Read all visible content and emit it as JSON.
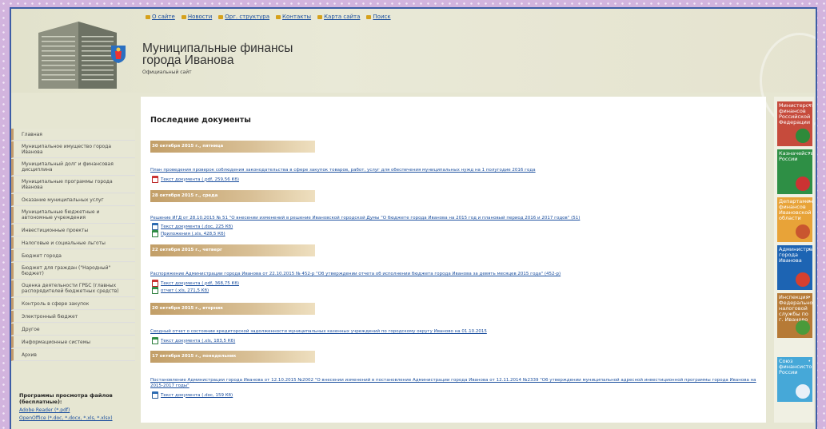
{
  "header": {
    "title_line1": "Муниципальные финансы",
    "title_line2": "города Иванова",
    "subtitle": "Официальный сайт"
  },
  "topnav": [
    "О сайте",
    "Новости",
    "Орг. структура",
    "Контакты",
    "Карта сайта",
    "Поиск"
  ],
  "sidebar": [
    "Главная",
    "Муниципальное имущество города Иванова",
    "Муниципальный долг и финансовая дисциплина",
    "Муниципальные программы города Иванова",
    "Оказание муниципальных услуг",
    "Муниципальные бюджетные и автономные учреждения",
    "Инвестиционные проекты",
    "Налоговые и социальные льготы",
    "Бюджет города",
    "Бюджет для граждан (\"Народный\" бюджет)",
    "Оценка деятельности ГРБС (главных распорядителей бюджетных средств)",
    "Контроль в сфере закупок",
    "Электронный бюджет",
    "Другое",
    "Информационные системы",
    "Архив"
  ],
  "viewers": {
    "title": "Программы просмотра файлов (бесплатные):",
    "links": [
      "Adobe Reader (*.pdf)",
      "OpenOffice (*.doc, *.docx, *.xls, *.xlsx)"
    ]
  },
  "main": {
    "heading": "Последние документы",
    "groups": [
      {
        "date": "30 октября 2015 г., пятница",
        "doc": "План проведения проверок соблюдения законодательства в сфере закупок товаров, работ, услуг для обеспечения муниципальных нужд на 1 полугодие 2016 года",
        "files": [
          {
            "type": "pdf",
            "label": "Текст документа (.pdf, 259,56 Кб)"
          }
        ]
      },
      {
        "date": "28 октября 2015 г., среда",
        "doc": "Решение ИГД от 28.10.2015 № 51 \"О внесении изменений в решение Ивановской городской Думы \"О бюджете города Иванова на 2015 год и плановый период 2016 и 2017 годов\" (51)",
        "files": [
          {
            "type": "doc",
            "label": "Текст документа (.doc, 225 Кб)"
          },
          {
            "type": "xls",
            "label": "Приложения (.xls, 428,5 Кб)"
          }
        ]
      },
      {
        "date": "22 октября 2015 г., четверг",
        "doc": "Распоряжение Администрации города Иванова от 22.10.2015 № 452-р \"Об утверждении отчета об исполнении бюджета города Иванова за девять месяцев 2015 года\" (452-р)",
        "files": [
          {
            "type": "pdf",
            "label": "Текст документа (.pdf, 368,75 Кб)"
          },
          {
            "type": "xls",
            "label": "отчет (.xls, 271,5 Кб)"
          }
        ]
      },
      {
        "date": "20 октября 2015 г., вторник",
        "doc": "Сводный отчет о состоянии кредиторской задолженности муниципальных казенных учреждений по городскому округу Иваново на 01.10.2015",
        "files": [
          {
            "type": "xls",
            "label": "Текст документа (.xls, 183,5 Кб)"
          }
        ]
      },
      {
        "date": "17 октября 2015 г., понедельник",
        "doc": "Постановление Администрации города Иванова от 12.10.2015 №2002 \"О внесении изменений в постановление Администрации города Иванова от 12.11.2014 №2339 \"Об утверждении муниципальной адресной инвестиционной программы города Иванова на 2015-2017 годы\"",
        "files": [
          {
            "type": "doc",
            "label": "Текст документа (.doc, 159 Кб)"
          }
        ]
      }
    ]
  },
  "right_tiles": [
    {
      "label": "Министерство финансов Российской Федерации",
      "color": "#c64b3c",
      "emblem": "#2e8a3a"
    },
    {
      "label": "Казначейство России",
      "color": "#2e8f45",
      "emblem": "#c33"
    },
    {
      "label": "Департамент финансов Ивановской области",
      "color": "#e8a338",
      "emblem": "#c9562f"
    },
    {
      "label": "Администрация города Иванова",
      "color": "#1d64b3",
      "emblem": "#d5402f"
    },
    {
      "label": "Инспекция Федеральной налоговой службы по г. Иваново",
      "color": "#b67a36",
      "emblem": "#4a9a3a"
    },
    {
      "label": "Союз финансистов России",
      "color": "#46a8d8",
      "emblem": "#e8f0f8"
    }
  ]
}
